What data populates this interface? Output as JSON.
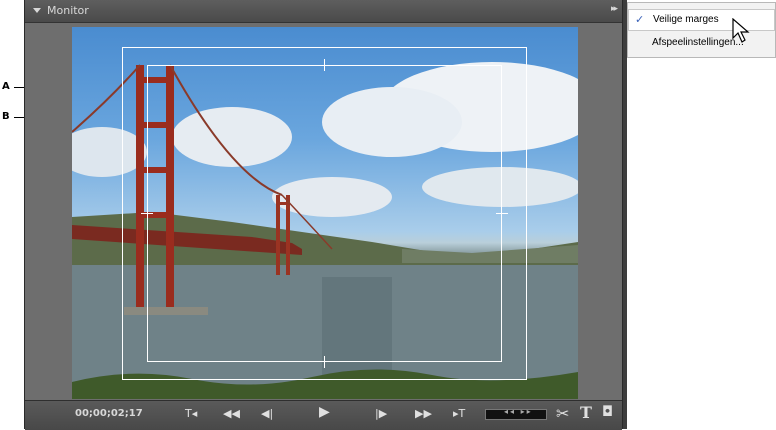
{
  "callouts": {
    "a": "A",
    "b": "B"
  },
  "panel": {
    "title": "Monitor",
    "menu_icon": "▸▸"
  },
  "controls": {
    "timecode": "00;00;02;17",
    "buttons": [
      {
        "name": "goto-in-button",
        "glyph": "T◂"
      },
      {
        "name": "rewind-button",
        "glyph": "◀◀"
      },
      {
        "name": "step-back-button",
        "glyph": "◀|"
      },
      {
        "name": "play-button",
        "glyph": "▶"
      },
      {
        "name": "step-forward-button",
        "glyph": "|▶"
      },
      {
        "name": "fast-forward-button",
        "glyph": "▶▶"
      },
      {
        "name": "goto-out-button",
        "glyph": "▸T"
      }
    ],
    "jog_glyph": "◂◂ ▸▸",
    "tools": {
      "scissors": "✂",
      "text": "T",
      "camera": "◘"
    }
  },
  "menu": {
    "items": [
      {
        "label": "Veilige marges",
        "checked": true
      },
      {
        "label": "Afspeelinstellingen...",
        "checked": false
      }
    ],
    "check_glyph": "✓"
  },
  "colors": {
    "panel_bg": "#6e6e6e",
    "menu_bg": "#f2f2f2",
    "check": "#3a62b8"
  }
}
